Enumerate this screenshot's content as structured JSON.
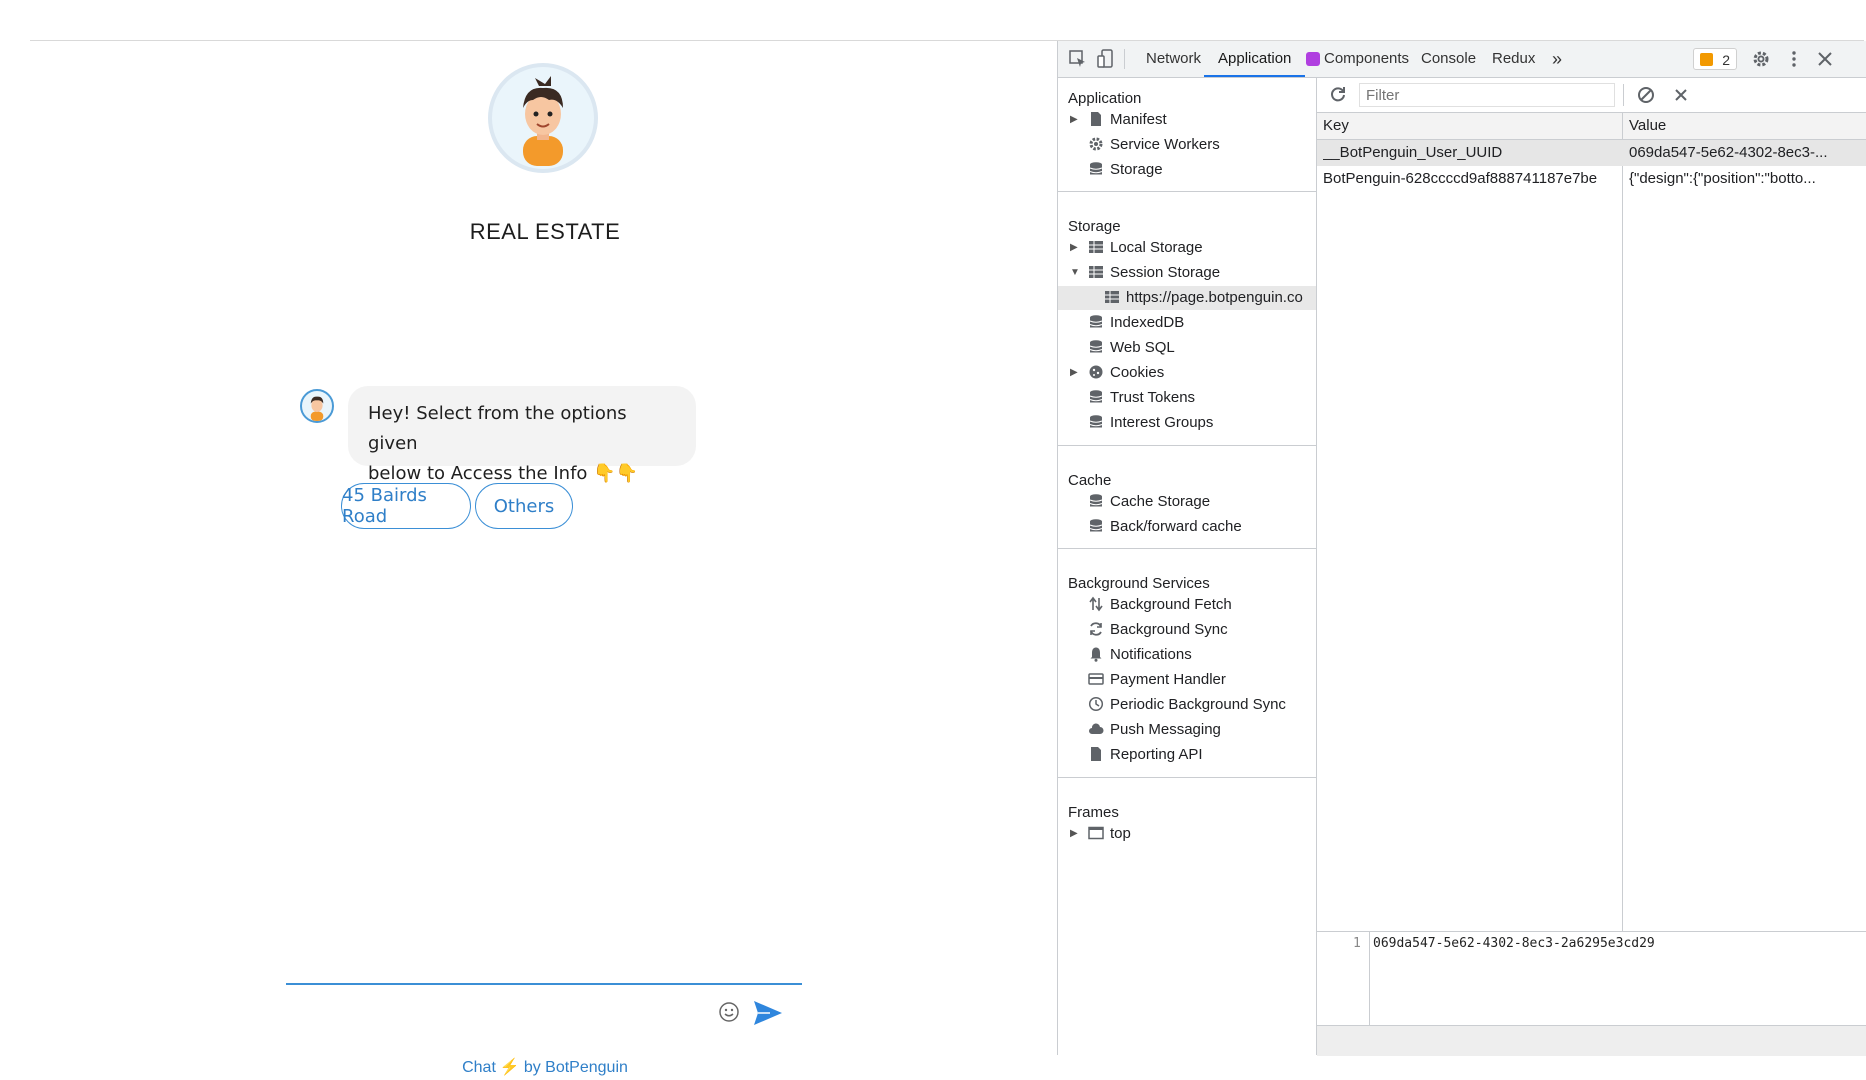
{
  "chat": {
    "title": "REAL ESTATE",
    "message_line1": "Hey! Select from the options given",
    "message_line2": "below to Access the Info 👇👇",
    "options": [
      "45 Bairds Road",
      "Others"
    ],
    "footer_chat": "Chat",
    "footer_by": "by BotPenguin",
    "accent_color": "#3b8fd6"
  },
  "devtools": {
    "tabs": [
      "Network",
      "Application",
      "Components",
      "Console",
      "Redux"
    ],
    "active_tab": "Application",
    "more_tabs": "»",
    "issues_count": "2",
    "sections": {
      "application": {
        "title": "Application",
        "items": [
          "Manifest",
          "Service Workers",
          "Storage"
        ]
      },
      "storage": {
        "title": "Storage",
        "items": [
          "Local Storage",
          "Session Storage",
          "https://page.botpenguin.co",
          "IndexedDB",
          "Web SQL",
          "Cookies",
          "Trust Tokens",
          "Interest Groups"
        ]
      },
      "cache": {
        "title": "Cache",
        "items": [
          "Cache Storage",
          "Back/forward cache"
        ]
      },
      "background": {
        "title": "Background Services",
        "items": [
          "Background Fetch",
          "Background Sync",
          "Notifications",
          "Payment Handler",
          "Periodic Background Sync",
          "Push Messaging",
          "Reporting API"
        ]
      },
      "frames": {
        "title": "Frames",
        "items": [
          "top"
        ]
      }
    },
    "filter_placeholder": "Filter",
    "table": {
      "headers": [
        "Key",
        "Value"
      ],
      "rows": [
        {
          "key": "__BotPenguin_User_UUID",
          "value": "069da547-5e62-4302-8ec3-..."
        },
        {
          "key": "BotPenguin-628ccccd9af888741187e7be",
          "value": "{\"design\":{\"position\":\"botto..."
        }
      ]
    },
    "preview": {
      "line_number": "1",
      "text": "069da547-5e62-4302-8ec3-2a6295e3cd29"
    }
  }
}
